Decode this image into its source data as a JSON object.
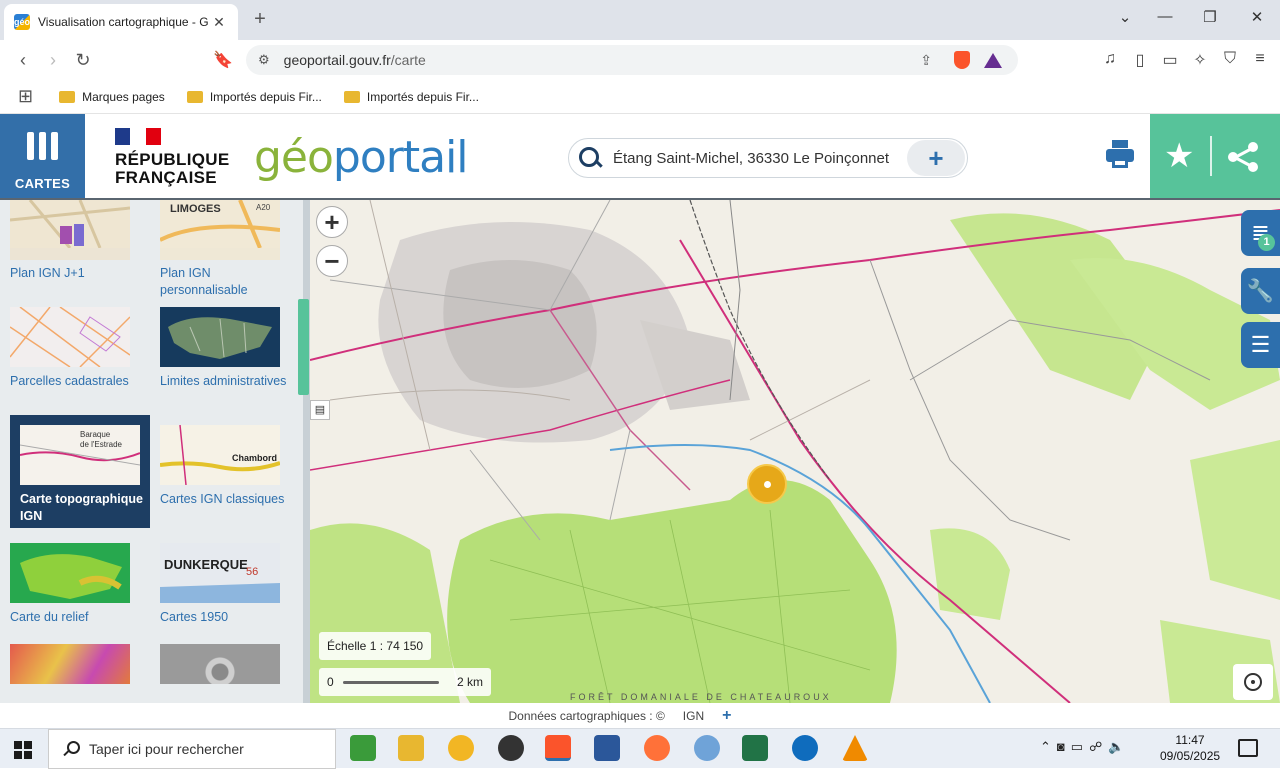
{
  "browser": {
    "tab_title": "Visualisation cartographique - G",
    "favicon_text": "géo",
    "url_domain": "geoportail.gouv.fr",
    "url_path": "/carte",
    "bookmarks": [
      {
        "label": "Marques pages"
      },
      {
        "label": "Importés depuis Fir..."
      },
      {
        "label": "Importés depuis Fir..."
      }
    ]
  },
  "header": {
    "cartes_label": "CARTES",
    "republique_line1": "RÉPUBLIQUE",
    "republique_line2": "FRANÇAISE",
    "logo_geo": "géo",
    "logo_portail": "portail",
    "search_value": "Étang Saint-Michel, 36330 Le Poinçonnet",
    "search_plus": "+",
    "colors": {
      "blue": "#336fa9",
      "green": "#57c39a",
      "dark": "#1d3e63"
    }
  },
  "sidebar": {
    "items": [
      {
        "label": "Plan IGN J+1"
      },
      {
        "label": "Plan IGN personnalisable"
      },
      {
        "label": "Parcelles cadastrales"
      },
      {
        "label": "Limites administratives"
      },
      {
        "label": "Carte topographique IGN",
        "active": true
      },
      {
        "label": "Cartes IGN classiques"
      },
      {
        "label": "Carte du relief"
      },
      {
        "label": "Cartes 1950"
      }
    ],
    "thumb_texts": {
      "limoges": "LIMOGES",
      "a20": "A20",
      "baraque": "Baraque",
      "estrade": "de l'Estrade",
      "chambord": "Chambord",
      "dunkerque": "DUNKERQUE",
      "dk_num": "56"
    }
  },
  "map": {
    "zoom_in": "+",
    "zoom_out": "−",
    "scale_label": "Échelle 1 :",
    "scale_value": "74 150",
    "scale_start": "0",
    "scale_end": "2 km",
    "forest_label": "FORÊT DOMANIALE DE CHATEAUROUX",
    "layers_badge": "1"
  },
  "attribution": {
    "text": "Données cartographiques : ©",
    "provider": "IGN",
    "more": "+"
  },
  "taskbar": {
    "search_placeholder": "Taper ici pour rechercher",
    "time": "11:47",
    "date": "09/05/2025"
  }
}
